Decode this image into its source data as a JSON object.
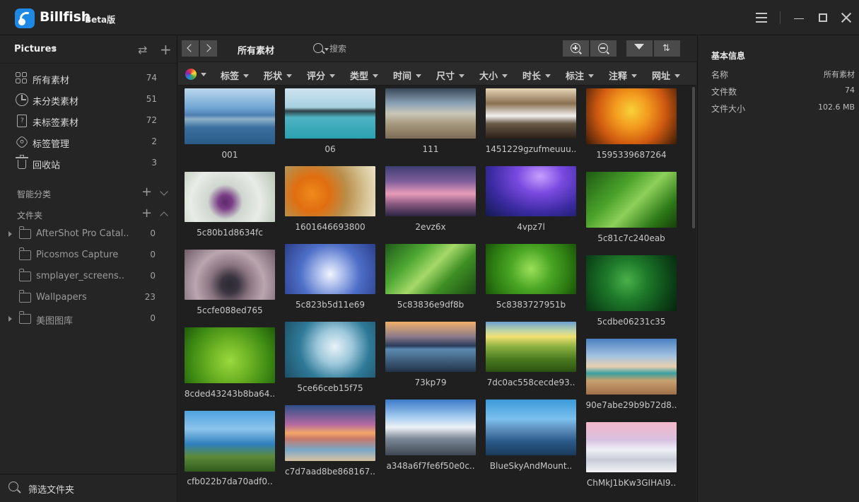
{
  "app": {
    "name": "Billfish",
    "tag": "Beta版"
  },
  "sidebar": {
    "library": "Pictures",
    "nav": [
      {
        "label": "所有素材",
        "count": "74",
        "icon": "grid-icon"
      },
      {
        "label": "未分类素材",
        "count": "51",
        "icon": "pie-icon"
      },
      {
        "label": "未标签素材",
        "count": "72",
        "icon": "tag-icon"
      },
      {
        "label": "标签管理",
        "count": "2",
        "icon": "tag-manage-icon"
      },
      {
        "label": "回收站",
        "count": "3",
        "icon": "trash-icon"
      }
    ],
    "smart_label": "智能分类",
    "folders_label": "文件夹",
    "folders": [
      {
        "label": "AfterShot Pro Catal..",
        "count": "0",
        "expandable": true
      },
      {
        "label": "Picosmos Capture",
        "count": "0",
        "expandable": false
      },
      {
        "label": "smplayer_screens..",
        "count": "0",
        "expandable": false
      },
      {
        "label": "Wallpapers",
        "count": "23",
        "expandable": false
      },
      {
        "label": "美图图库",
        "count": "0",
        "expandable": true
      }
    ],
    "filter_label": "筛选文件夹"
  },
  "toolbar": {
    "title": "所有素材",
    "search_placeholder": "搜索",
    "filters": [
      "标签",
      "形状",
      "评分",
      "类型",
      "时间",
      "尺寸",
      "大小",
      "时长",
      "标注",
      "注释",
      "网址"
    ]
  },
  "items": [
    {
      "name": "001"
    },
    {
      "name": "5c80b1d8634fc"
    },
    {
      "name": "5ccfe088ed765"
    },
    {
      "name": "8cded43243b8ba64.."
    },
    {
      "name": "cfb022b7da70adf0.."
    },
    {
      "name": "06"
    },
    {
      "name": "1601646693800"
    },
    {
      "name": "5c823b5d11e69"
    },
    {
      "name": "5ce66ceb15f75"
    },
    {
      "name": "c7d7aad8be868167.."
    },
    {
      "name": "111"
    },
    {
      "name": "2evz6x"
    },
    {
      "name": "5c83836e9df8b"
    },
    {
      "name": "73kp79"
    },
    {
      "name": "a348a6f7fe6f50e0c.."
    },
    {
      "name": "1451229gzufmeuuu.."
    },
    {
      "name": "4vpz7l"
    },
    {
      "name": "5c8383727951b"
    },
    {
      "name": "7dc0ac558cecde93.."
    },
    {
      "name": "BlueSkyAndMount.."
    },
    {
      "name": "1595339687264"
    },
    {
      "name": "5c81c7c240eab"
    },
    {
      "name": "5cdbe06231c35"
    },
    {
      "name": "90e7abe29b9b72d8.."
    },
    {
      "name": "ChMkJ1bKw3GIHAI9.."
    }
  ],
  "inspector": {
    "title": "基本信息",
    "rows": [
      {
        "key": "名称",
        "value": "所有素材"
      },
      {
        "key": "文件数",
        "value": "74"
      },
      {
        "key": "文件大小",
        "value": "102.6 MB"
      }
    ]
  }
}
